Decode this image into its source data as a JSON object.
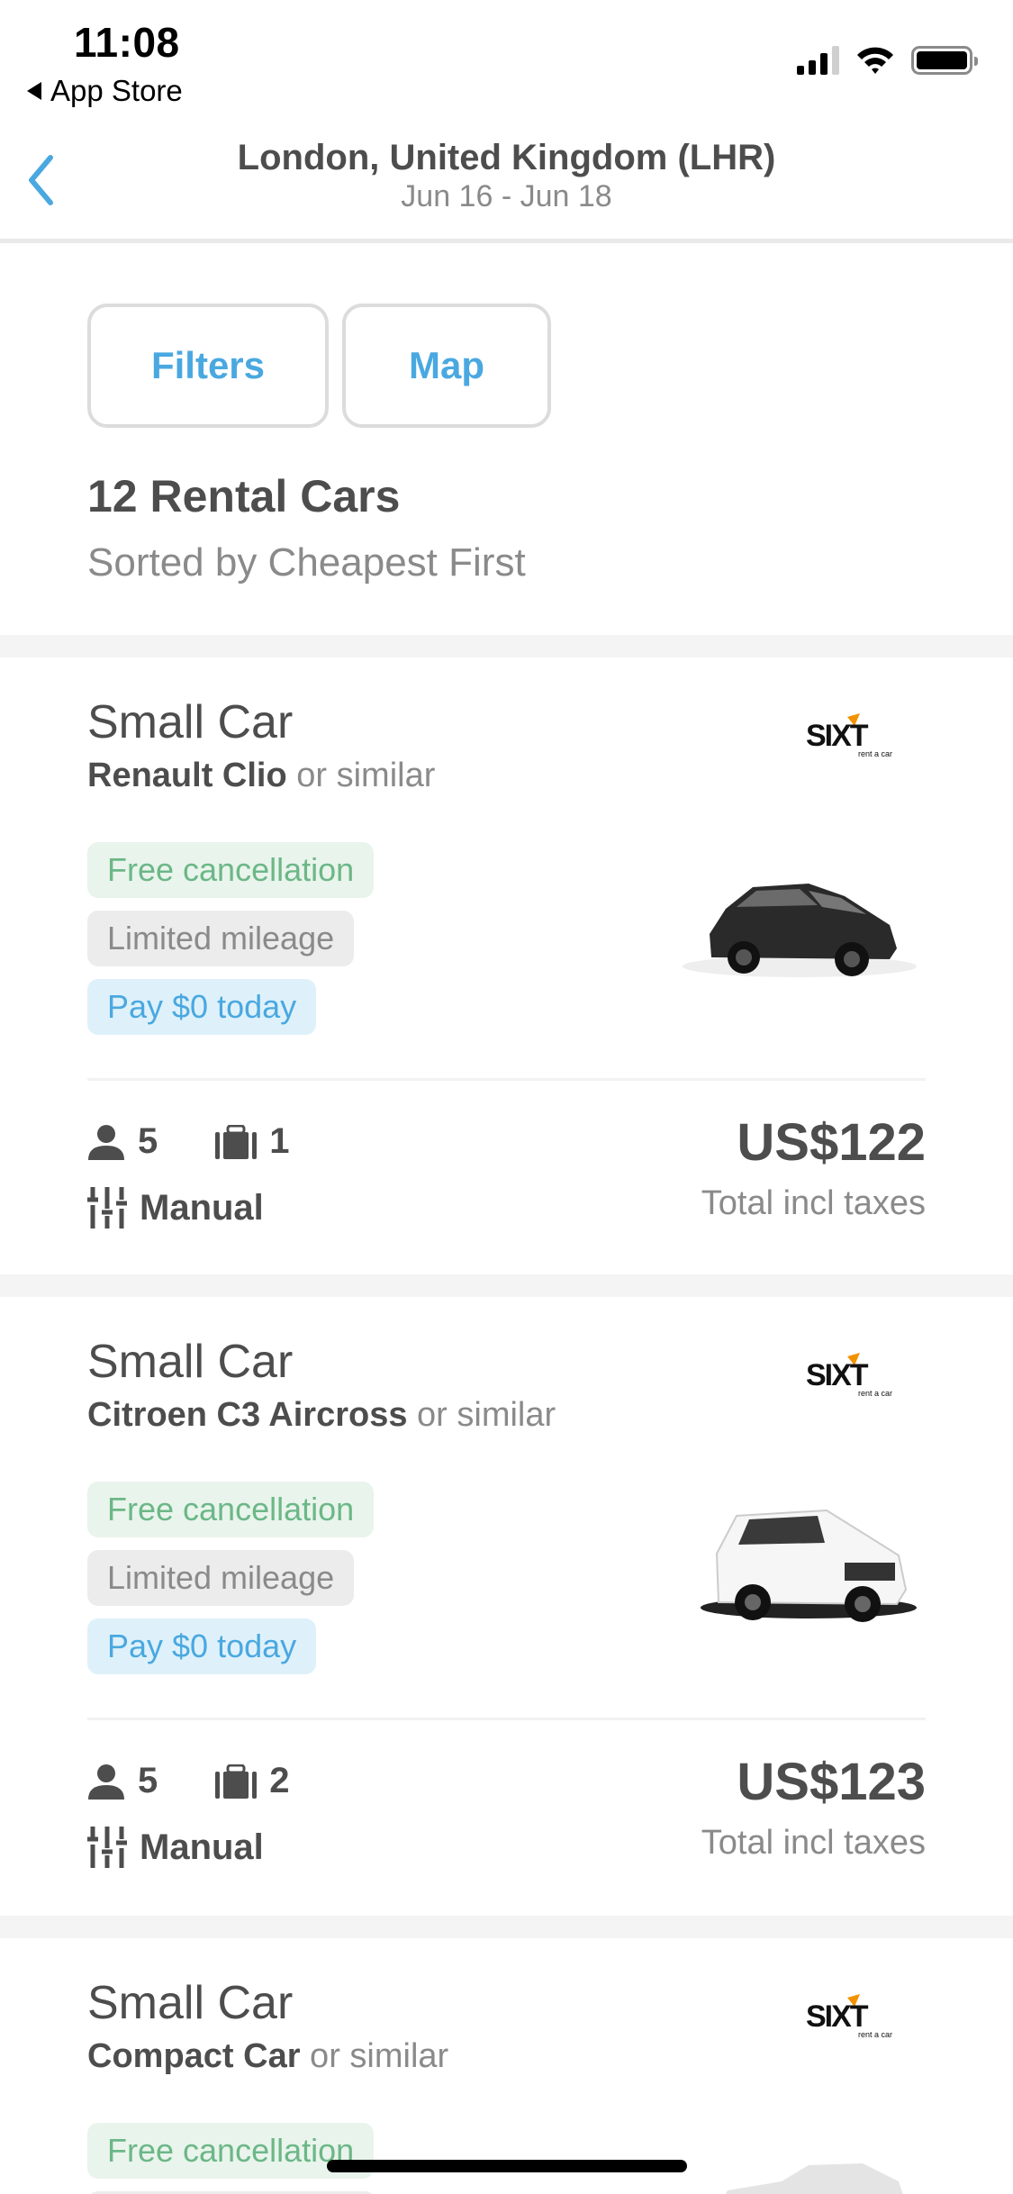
{
  "status_bar": {
    "time": "11:08",
    "back_app_label": "App Store",
    "signal_bars_filled": 3,
    "signal_bars_total": 4,
    "wifi_icon": "wifi-icon",
    "battery_level": 1.0
  },
  "nav": {
    "back_icon": "chevron-left-icon",
    "title": "London, United Kingdom (LHR)",
    "subtitle": "Jun 16 - Jun 18"
  },
  "toolbar": {
    "filters_label": "Filters",
    "map_label": "Map"
  },
  "results": {
    "count_label": "12 Rental Cars",
    "sort_label": "Sorted by Cheapest First"
  },
  "colors": {
    "accent": "#4aa8e0",
    "green_text": "#6cb787",
    "green_bg": "#e9f4ec",
    "gray_badge_bg": "#ececec",
    "blue_badge_bg": "#def1fa",
    "text_primary": "#4d4d4d",
    "text_secondary": "#8a8a8a"
  },
  "cars": [
    {
      "category": "Small Car",
      "model": "Renault Clio",
      "similar": " or similar",
      "vendor": "Sixt rent a car",
      "vendor_logo_text": "SIXT",
      "vendor_logo_sub": "rent a car",
      "car_color": "black",
      "badges": [
        "Free cancellation",
        "Limited mileage",
        "Pay $0 today"
      ],
      "passengers": "5",
      "bags": "1",
      "transmission": "Manual",
      "price": "US$122",
      "price_note": "Total incl taxes"
    },
    {
      "category": "Small Car",
      "model": "Citroen C3 Aircross",
      "similar": " or similar",
      "vendor": "Sixt rent a car",
      "vendor_logo_text": "SIXT",
      "vendor_logo_sub": "rent a car",
      "car_color": "white",
      "badges": [
        "Free cancellation",
        "Limited mileage",
        "Pay $0 today"
      ],
      "passengers": "5",
      "bags": "2",
      "transmission": "Manual",
      "price": "US$123",
      "price_note": "Total incl taxes"
    },
    {
      "category": "Small Car",
      "model": "Compact Car",
      "similar": " or similar",
      "vendor": "Sixt rent a car",
      "vendor_logo_text": "SIXT",
      "vendor_logo_sub": "rent a car",
      "car_color": "silver",
      "badges": [
        "Free cancellation"
      ]
    }
  ]
}
